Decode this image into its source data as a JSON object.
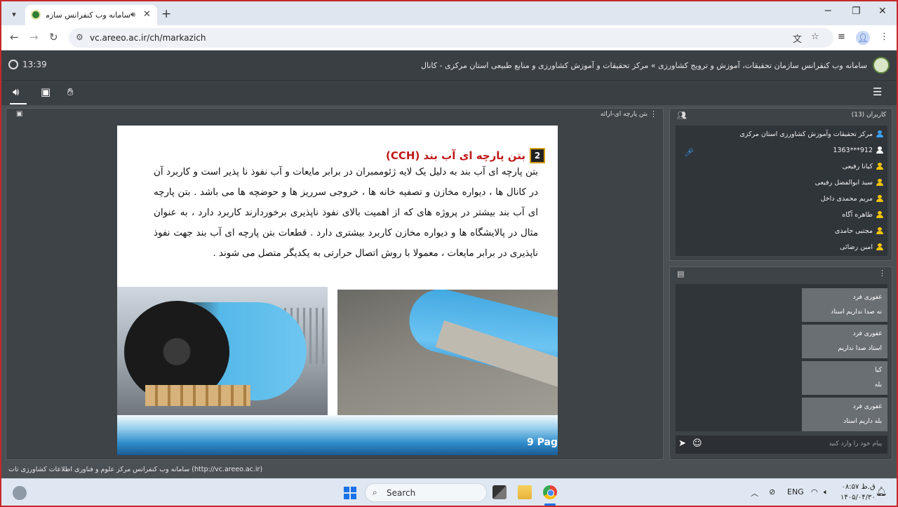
{
  "browser": {
    "tab_title": "سامانه وب کنفرانس سازمان",
    "url": "vc.areeo.ac.ir/ch/markazich",
    "icons": [
      "tab-dropdown-icon",
      "site-favicon-icon",
      "sound-icon",
      "close-icon",
      "new-tab-icon",
      "minimize-icon",
      "maximize-icon",
      "window-close-icon",
      "back-icon",
      "forward-icon",
      "reload-icon",
      "site-info-icon",
      "translate-icon",
      "star-icon",
      "media-icon",
      "profile-icon",
      "menu-icon"
    ]
  },
  "app": {
    "clock": "13:39",
    "title": "سامانه وب کنفرانس سازمان تحقیقات، آموزش و ترویج کشاورزی » مرکز تحقیقات و آموزش کشاورزی و منابع طبیعی استان مرکزی - کانال"
  },
  "presentation": {
    "header_title": "بتن پارچه ای-ارائه",
    "slide": {
      "number": "2",
      "title": "بتن پارچه ای آب بند (CCH)",
      "body": "بتن پارچه ای آب بند به دلیل یک لایه ژئوممبران در برابر مایعات و آب نفوذ نا پذیر است و کاربرد آن در کانال ها ، دیواره مخازن و تصفیه خانه ها ، خروجی سرریز ها و حوضچه ها می باشد . بتن پارچه ای آب بند بیشتر در پروژه های که از اهمیت بالای نفوذ ناپذیری برخوردارند کاربرد دارد ، به عنوان مثال در پالایشگاه ها و دیواره مخازن کاربرد بیشتری دارد . قطعات بتن پارچه ای آب بند جهت نفوذ ناپذیری در برابر مایعات ، معمولا با روش اتصال حرارتی به یکدیگر متصل می شوند .",
      "page_label": "9 Pag",
      "title_color": "#c01818"
    }
  },
  "users": {
    "title": "کاربران (13)",
    "list": [
      {
        "name": "مرکز تحقیقات وآموزش کشاورزی استان مرکزی",
        "color": "#3aa0ff"
      },
      {
        "name": "912***1363",
        "color": "#ffffff"
      },
      {
        "name": "کیانا رفیعی",
        "color": "#f2c400"
      },
      {
        "name": "سید ابوالفضل رفیعی",
        "color": "#f2c400"
      },
      {
        "name": "مریم محمدی داخل",
        "color": "#f2c400"
      },
      {
        "name": "طاهره آگاه",
        "color": "#f2c400"
      },
      {
        "name": "مجتبی حامدی",
        "color": "#f2c400"
      },
      {
        "name": "امین رضائی",
        "color": "#f2c400"
      }
    ]
  },
  "chat": {
    "messages": [
      {
        "sender": "غفوری فرد",
        "text": "نه صدا نداریم استاد"
      },
      {
        "sender": "غفوری فرد",
        "text": "استاد صدا نداریم"
      },
      {
        "sender": "کیا",
        "text": "بله"
      },
      {
        "sender": "غفوری فرد",
        "text": "بله داریم استاد"
      }
    ],
    "input_placeholder": "پیام خود را وارد کنید"
  },
  "footer": {
    "text": "سامانه وب کنفرانس مرکز علوم و فناوری اطلاعات کشاورزی تات (http://vc.areeo.ac.ir)"
  },
  "taskbar": {
    "search_label": "Search",
    "language": "ENG",
    "time": "۰۸:۵۷ ق.ظ",
    "date": "۱۴۰۵/۰۴/۳۰"
  }
}
